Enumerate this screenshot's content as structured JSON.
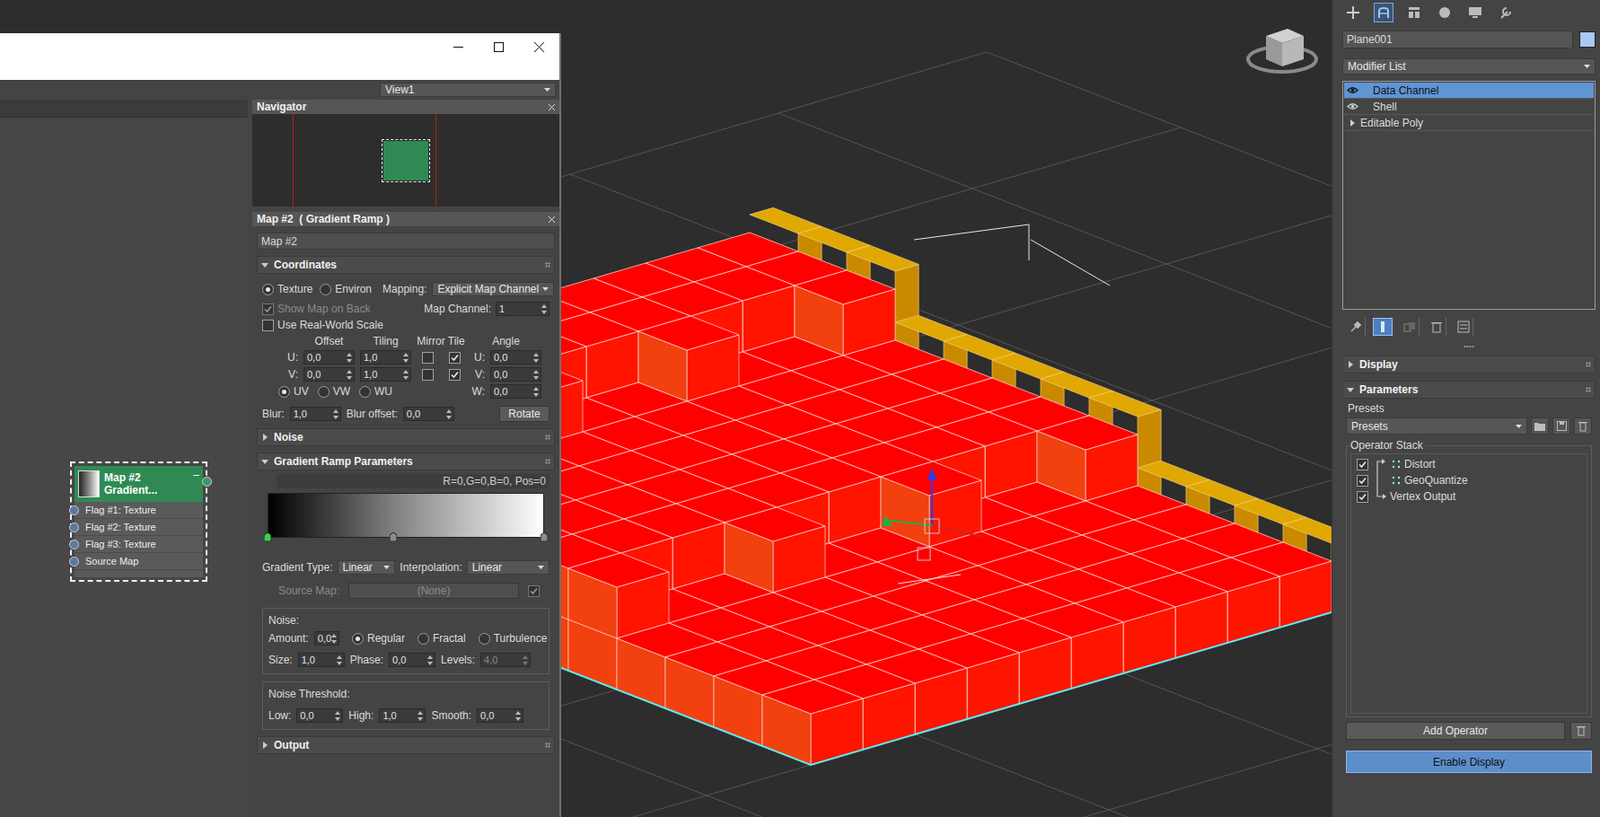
{
  "material_editor": {
    "view_selector": "View1",
    "navigator": {
      "title": "Navigator"
    },
    "node": {
      "title": "Map #2",
      "subtitle": "Gradient...",
      "collapse": "–",
      "selected": true,
      "slots": [
        "Flag #1: Texture",
        "Flag #2: Texture",
        "Flag #3: Texture",
        "Source Map"
      ]
    },
    "params": {
      "title": "Map #2  ( Gradient Ramp )",
      "name": "Map #2",
      "coordinates": {
        "title": "Coordinates",
        "expanded": true,
        "projection": [
          {
            "label": "Texture",
            "selected": true
          },
          {
            "label": "Environ",
            "selected": false
          }
        ],
        "mapping_label": "Mapping:",
        "mapping": "Explicit Map Channel",
        "show_map_on_back": {
          "label": "Show Map on Back",
          "checked": true,
          "disabled": true
        },
        "map_channel_label": "Map Channel:",
        "map_channel": "1",
        "real_world": {
          "label": "Use Real-World Scale",
          "checked": false
        },
        "columns": [
          "Offset",
          "Tiling",
          "Mirror Tile",
          "Angle"
        ],
        "rows": [
          {
            "axis": "U:",
            "offset": "0,0",
            "tiling": "1,0",
            "mirror": false,
            "tile": true,
            "angle_axis": "U:",
            "angle": "0,0"
          },
          {
            "axis": "V:",
            "offset": "0,0",
            "tiling": "1,0",
            "mirror": false,
            "tile": true,
            "angle_axis": "V:",
            "angle": "0,0"
          }
        ],
        "w_angle": {
          "axis": "W:",
          "value": "0,0"
        },
        "planes": [
          {
            "label": "UV",
            "selected": true
          },
          {
            "label": "VW",
            "selected": false
          },
          {
            "label": "WU",
            "selected": false
          }
        ],
        "blur_label": "Blur:",
        "blur": "1,0",
        "blur_offset_label": "Blur offset:",
        "blur_offset": "0,0",
        "rotate": "Rotate"
      },
      "noise_rollout": {
        "title": "Noise",
        "expanded": false
      },
      "gradient": {
        "title": "Gradient Ramp Parameters",
        "expanded": true,
        "info": "R=0,G=0,B=0, Pos=0",
        "flags": [
          {
            "level": 0,
            "color": "#000000",
            "selected": true
          },
          {
            "level": 0.455,
            "color": "#808080",
            "selected": false
          },
          {
            "level": 1,
            "color": "#ffffff",
            "selected": false
          }
        ],
        "gradient_type_label": "Gradient Type:",
        "gradient_type": "Linear",
        "interpolation_label": "Interpolation:",
        "interpolation": "Linear",
        "source_map_label": "Source Map:",
        "source_map": "(None)",
        "source_map_disabled": true,
        "source_map_check": {
          "checked": true,
          "disabled": true
        },
        "noise": {
          "title": "Noise:",
          "amount_label": "Amount:",
          "amount": "0,0",
          "types": [
            {
              "label": "Regular",
              "selected": true
            },
            {
              "label": "Fractal",
              "selected": false
            },
            {
              "label": "Turbulence",
              "selected": false
            }
          ],
          "size_label": "Size:",
          "size": "1,0",
          "phase_label": "Phase:",
          "phase": "0,0",
          "levels_label": "Levels:",
          "levels": "4,0",
          "levels_disabled": true
        },
        "threshold": {
          "title": "Noise Threshold:",
          "fields": [
            {
              "label": "Low:",
              "value": "0,0"
            },
            {
              "label": "High:",
              "value": "1,0"
            },
            {
              "label": "Smooth:",
              "value": "0,0"
            }
          ]
        }
      },
      "output": {
        "title": "Output",
        "expanded": false
      }
    }
  },
  "command_panel": {
    "tabs": [
      {
        "selected": false
      },
      {
        "selected": true
      },
      {
        "selected": false
      },
      {
        "selected": false
      },
      {
        "selected": false
      },
      {
        "selected": false
      }
    ],
    "object_name": "Plane001",
    "object_color": "#a9c9f2",
    "modifier_list": "Modifier List",
    "stack": [
      {
        "label": "Data Channel",
        "kind": "modifier",
        "visible": true,
        "selected": true,
        "expanded": false
      },
      {
        "label": "Shell",
        "kind": "modifier",
        "visible": true,
        "selected": false,
        "expanded": false
      },
      {
        "label": "Editable Poly",
        "kind": "base",
        "visible": false,
        "selected": false,
        "expanded": false
      }
    ],
    "stack_tools": [
      {
        "active": false
      },
      {
        "active": true
      },
      {
        "active": false
      },
      {
        "active": false
      },
      {
        "active": false
      }
    ],
    "display_rollout": {
      "title": "Display",
      "expanded": false
    },
    "parameters_rollout": {
      "title": "Parameters",
      "expanded": true
    },
    "presets_label": "Presets",
    "presets": "Presets",
    "operator_stack": {
      "title": "Operator Stack",
      "items": [
        {
          "label": "Distort",
          "kind": "operator",
          "checked": true
        },
        {
          "label": "GeoQuantize",
          "kind": "operator",
          "checked": true
        },
        {
          "label": "Vertex Output",
          "kind": "output",
          "checked": true
        }
      ]
    },
    "add_operator": "Add Operator",
    "enable_display": "Enable Display"
  }
}
